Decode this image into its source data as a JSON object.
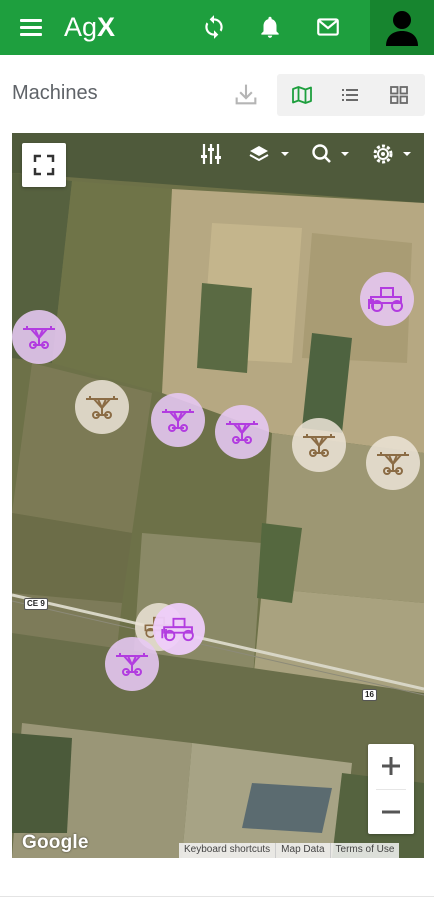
{
  "app": {
    "brand_prefix": "Ag",
    "brand_suffix": "X",
    "colors": {
      "header": "#1e9f3e",
      "avatar_bg": "#17852f",
      "active_view": "#1e9f3e",
      "marker_purple": "#b23ce0",
      "marker_tan": "#8b6c45"
    },
    "icons": [
      "menu-icon",
      "sync-icon",
      "bell-icon",
      "mail-icon",
      "user-avatar-icon"
    ]
  },
  "page": {
    "title": "Machines",
    "views": [
      "map-view",
      "list-view",
      "grid-view"
    ],
    "active_view": "map-view"
  },
  "map": {
    "provider_logo": "Google",
    "attribution": [
      "Keyboard shortcuts",
      "Map Data",
      "Terms of Use"
    ],
    "road_labels": [
      "CE 9",
      "16"
    ],
    "zoom_in": "+",
    "zoom_out": "−",
    "markers": [
      {
        "type": "pivot",
        "color": "purple"
      },
      {
        "type": "tractor",
        "color": "purple"
      },
      {
        "type": "pivot",
        "color": "tan"
      },
      {
        "type": "pivot",
        "color": "purple"
      },
      {
        "type": "pivot",
        "color": "purple"
      },
      {
        "type": "pivot",
        "color": "tan"
      },
      {
        "type": "pivot",
        "color": "tan"
      },
      {
        "type": "tractor",
        "color": "tan"
      },
      {
        "type": "tractor",
        "color": "purple"
      },
      {
        "type": "pivot",
        "color": "purple"
      }
    ]
  }
}
